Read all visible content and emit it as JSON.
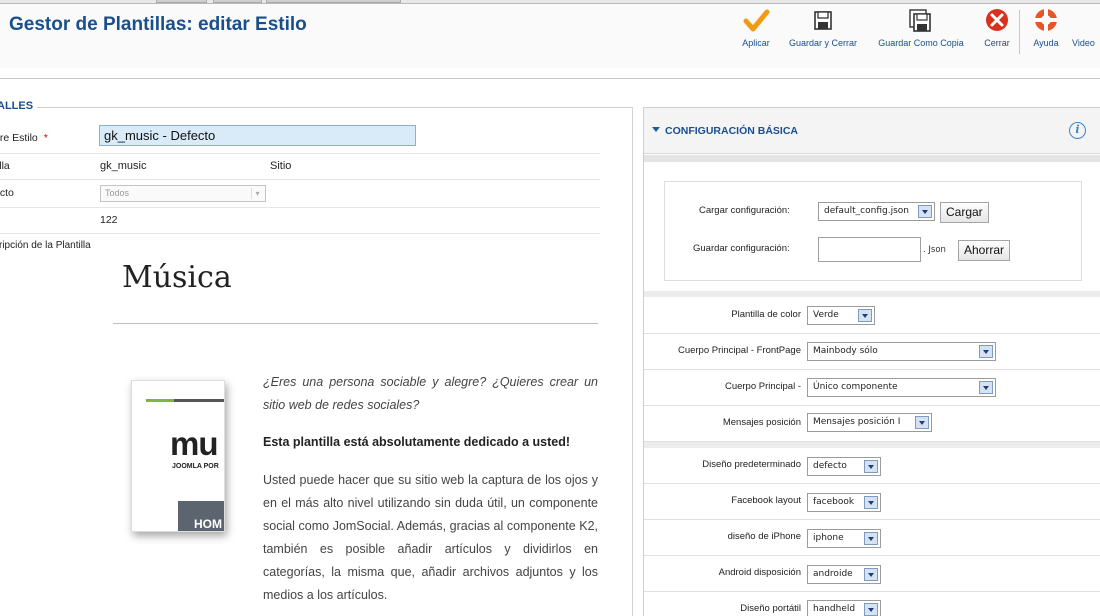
{
  "header": {
    "title": "Gestor de Plantillas: editar Estilo",
    "toolbar": [
      {
        "key": "apply",
        "label": "Aplicar",
        "icon": "check-icon"
      },
      {
        "key": "save_close",
        "label": "Guardar y Cerrar",
        "icon": "save-icon"
      },
      {
        "key": "save_copy",
        "label": "Guardar Como Copia",
        "icon": "save-copy-icon"
      },
      {
        "key": "close",
        "label": "Cerrar",
        "icon": "close-icon"
      },
      {
        "key": "help",
        "label": "Ayuda",
        "icon": "help-lifebuoy-icon"
      },
      {
        "key": "video",
        "label": "Video",
        "icon": "video-icon"
      }
    ]
  },
  "details": {
    "legend": "ALLES",
    "name_label": "bre Estilo",
    "required_mark": "*",
    "name_value": "gk_music - Defecto",
    "template_label": "tilla",
    "template_value": "gk_music",
    "site_value": "Sitio",
    "default_label": "ecto",
    "default_select": "Todos",
    "id_value": "122",
    "description_label": "cripción de la Plantilla"
  },
  "description": {
    "title": "Música",
    "thumb": {
      "logo": "mu",
      "tagline": "JOOMLA POR",
      "home": "HOM"
    },
    "italic_text": "¿Eres una persona sociable y alegre? ¿Quieres crear un sitio web de redes sociales?",
    "bold_text": "Esta plantilla está absolutamente dedicado a usted!",
    "paragraph": "Usted puede hacer que su sitio web la captura de los ojos y en el más alto nivel utilizando sin duda útil, un componente social como JomSocial. Además, gracias al componente K2, también es posible añadir artículos y dividirlos en categorías, la misma que, añadir archivos adjuntos y los medios a los artículos."
  },
  "config": {
    "panel_title": "CONFIGURACIÓN BÁSICA",
    "load_label": "Cargar configuración:",
    "load_select": "default_config.json",
    "load_button": "Cargar",
    "save_label": "Guardar configuración:",
    "json_suffix": ". Json",
    "save_button": "Ahorrar",
    "options": [
      {
        "label": "Plantilla de color",
        "value": "Verde"
      },
      {
        "label": "Cuerpo Principal - FrontPage",
        "value": "Mainbody sólo"
      },
      {
        "label": "Cuerpo Principal -",
        "value": "Único componente"
      },
      {
        "label": "Mensajes posición",
        "value": "Mensajes posición I"
      },
      {
        "label": "Diseño predeterminado",
        "value": "defecto"
      },
      {
        "label": "Facebook layout",
        "value": "facebook"
      },
      {
        "label": "diseño de iPhone",
        "value": "iphone"
      },
      {
        "label": "Android disposición",
        "value": "androide"
      },
      {
        "label": "Diseño portátil",
        "value": "handheld"
      }
    ]
  },
  "colors": {
    "title_blue": "#1a4f8b",
    "apply_orange": "#f29a14",
    "close_red": "#d8311d",
    "input_highlight": "#d9ebf8"
  }
}
